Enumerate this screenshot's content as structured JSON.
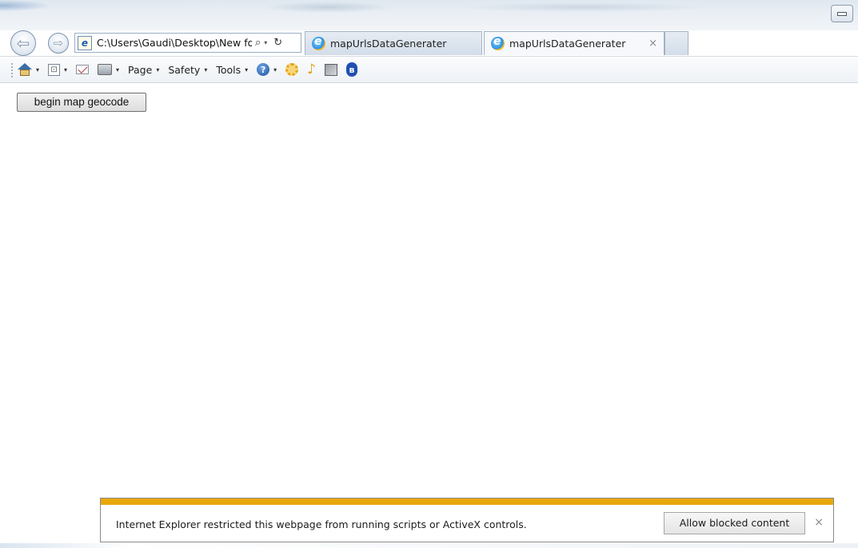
{
  "window": {
    "minimize_icon": "minimize-icon"
  },
  "navigation": {
    "back_icon": "back-arrow-icon",
    "back_glyph": "⇦",
    "forward_icon": "forward-arrow-icon",
    "forward_glyph": "⇨",
    "address_bar": {
      "page_icon_glyph": "e",
      "url": "C:\\Users\\Gaudi\\Desktop\\New fo",
      "search_glyph": "⌕",
      "dropdown_glyph": "▾",
      "refresh_glyph": "↻"
    }
  },
  "tabs": [
    {
      "label": "mapUrlsDataGenerater",
      "active": false
    },
    {
      "label": "mapUrlsDataGenerater",
      "active": true,
      "close_glyph": "×"
    }
  ],
  "command_bar": {
    "caret_glyph": "▾",
    "feed_glyph": "⊡",
    "help_glyph": "?",
    "tool_glyph": "♪",
    "bluetooth_glyph": "ʙ",
    "menus": [
      {
        "label": "Page"
      },
      {
        "label": "Safety"
      },
      {
        "label": "Tools"
      }
    ]
  },
  "page": {
    "geocode_button_label": "begin map geocode"
  },
  "notification": {
    "message": "Internet Explorer restricted this webpage from running scripts or ActiveX controls.",
    "allow_button_label": "Allow blocked content",
    "close_glyph": "×",
    "accent_color": "#e8a80c"
  }
}
